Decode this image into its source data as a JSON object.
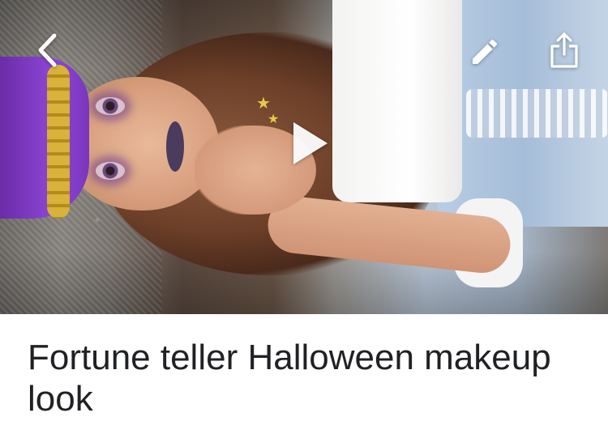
{
  "media": {
    "alt": "Fortune teller costume photo",
    "controls": {
      "back_icon": "chevron-left-icon",
      "edit_icon": "pencil-icon",
      "share_icon": "share-icon",
      "play_icon": "play-icon"
    }
  },
  "article": {
    "title": "Fortune teller Halloween makeup look"
  },
  "colors": {
    "overlay_icon": "#ffffff",
    "title_text": "#202124",
    "background": "#ffffff"
  }
}
